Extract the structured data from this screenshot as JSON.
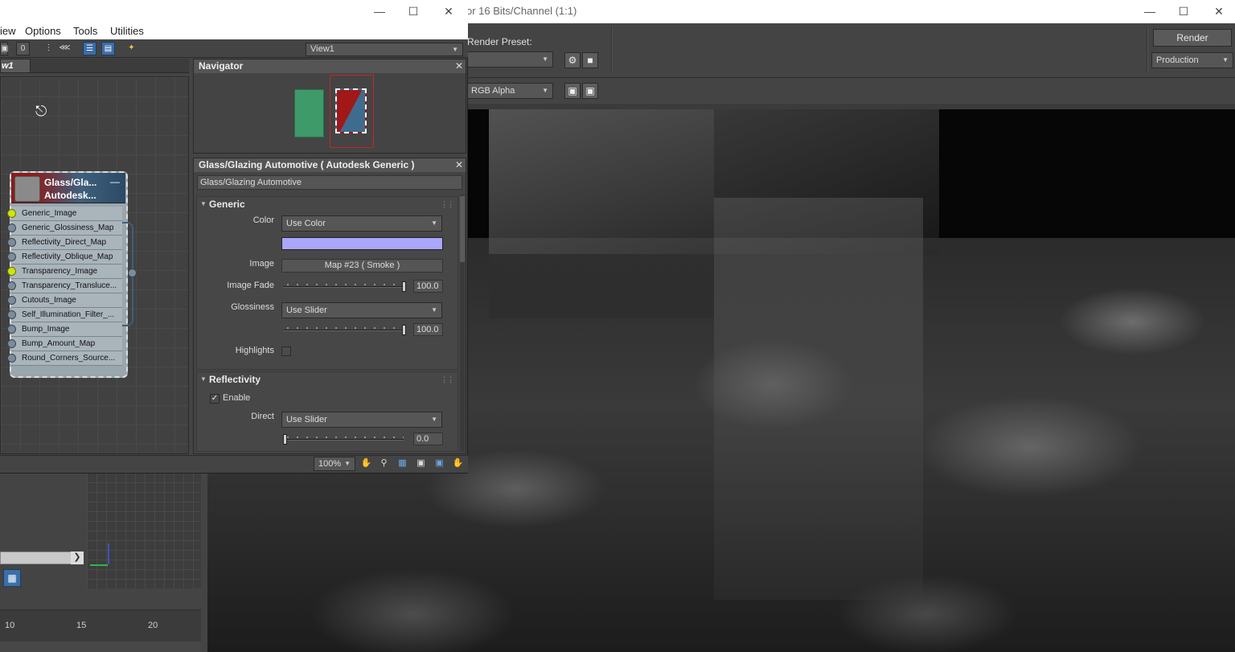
{
  "render_frame": {
    "title": "or 16 Bits/Channel (1:1)",
    "render_preset_label": "Render Preset:",
    "render_preset_value": "",
    "channel_value": "RGB Alpha",
    "render_button": "Render",
    "render_mode": "Production"
  },
  "slate": {
    "menu": [
      "iew",
      "Options",
      "Tools",
      "Utilities"
    ],
    "view_selector": "View1",
    "view_tab": "w1",
    "node": {
      "title_line1": "Glass/Gla...",
      "title_line2": "Autodesk...",
      "collapse": "—",
      "slots": [
        {
          "label": "Generic_Image",
          "linked": true
        },
        {
          "label": "Generic_Glossiness_Map",
          "linked": false
        },
        {
          "label": "Reflectivity_Direct_Map",
          "linked": false
        },
        {
          "label": "Reflectivity_Oblique_Map",
          "linked": false
        },
        {
          "label": "Transparency_Image",
          "linked": true
        },
        {
          "label": "Transparency_Transluce...",
          "linked": false
        },
        {
          "label": "Cutouts_Image",
          "linked": false
        },
        {
          "label": "Self_Illumination_Filter_...",
          "linked": false
        },
        {
          "label": "Bump_Image",
          "linked": false
        },
        {
          "label": "Bump_Amount_Map",
          "linked": false
        },
        {
          "label": "Round_Corners_Source...",
          "linked": false
        }
      ]
    },
    "navigator_title": "Navigator",
    "params": {
      "panel_title": "Glass/Glazing Automotive  ( Autodesk Generic )",
      "material_name": "Glass/Glazing Automotive",
      "generic_section": "Generic",
      "color_label": "Color",
      "color_mode": "Use Color",
      "color_value": "#a9a6fb",
      "image_label": "Image",
      "image_value": "Map #23  ( Smoke )",
      "image_fade_label": "Image Fade",
      "image_fade_value": "100.0",
      "glossiness_label": "Glossiness",
      "glossiness_mode": "Use Slider",
      "glossiness_value": "100.0",
      "highlights_label": "Highlights",
      "reflectivity_section": "Reflectivity",
      "enable_label": "Enable",
      "enable_checked": true,
      "direct_label": "Direct",
      "direct_mode": "Use Slider",
      "direct_value": "0.0"
    },
    "zoom": "100%"
  },
  "timeline": {
    "ticks": [
      "10",
      "15",
      "20"
    ]
  }
}
